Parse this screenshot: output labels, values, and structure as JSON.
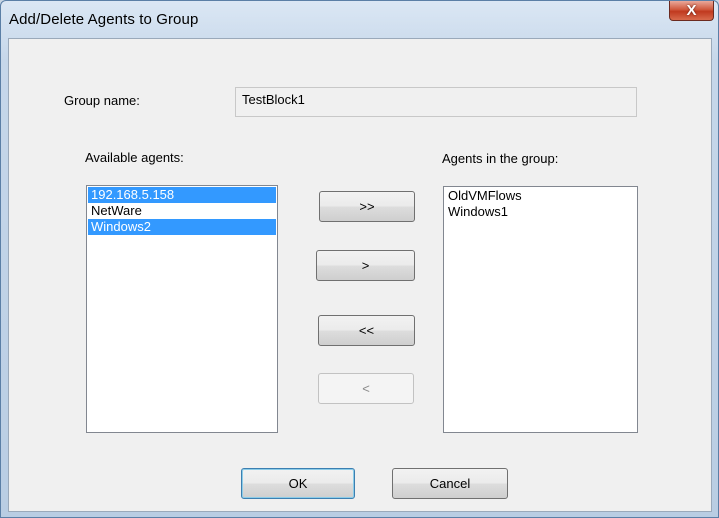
{
  "window": {
    "title": "Add/Delete Agents to Group",
    "close_glyph": "X"
  },
  "group": {
    "label": "Group name:",
    "value": "TestBlock1"
  },
  "available": {
    "label": "Available agents:",
    "items": [
      {
        "label": "192.168.5.158",
        "selected": true
      },
      {
        "label": "NetWare",
        "selected": false
      },
      {
        "label": "Windows2",
        "selected": true
      }
    ]
  },
  "in_group": {
    "label": "Agents in the group:",
    "items": [
      {
        "label": "OldVMFlows",
        "selected": false
      },
      {
        "label": "Windows1",
        "selected": false
      }
    ]
  },
  "transfer": {
    "add_all": ">>",
    "add_selected": ">",
    "remove_all": "<<",
    "remove_selected": "<"
  },
  "footer": {
    "ok": "OK",
    "cancel": "Cancel"
  },
  "colors": {
    "selection": "#3399ff",
    "close_button": "#c0391f"
  }
}
